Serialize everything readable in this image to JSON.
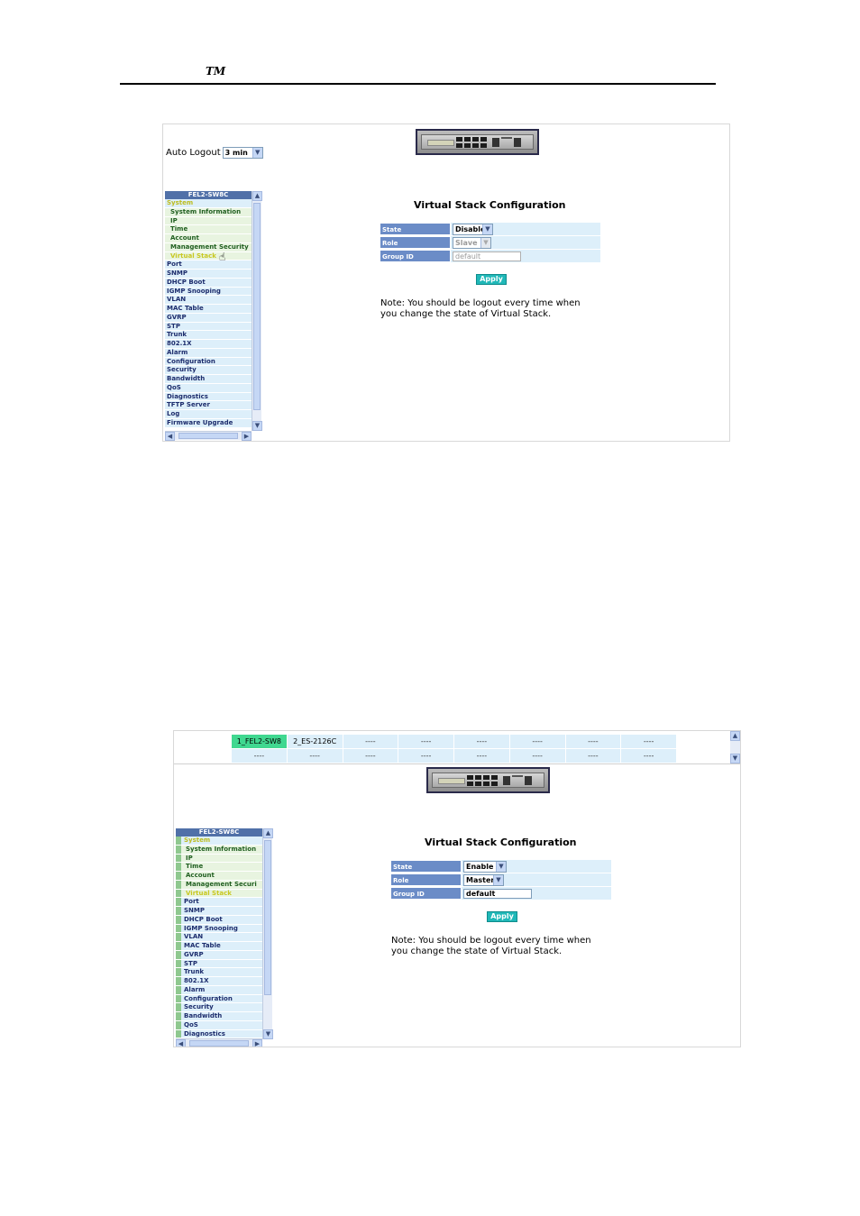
{
  "header": {
    "trademark": "TM"
  },
  "screenshot1": {
    "auto_logout_label": "Auto Logout",
    "auto_logout_value": "3 min",
    "menu_title": "FEL2-SW8C",
    "menu_items": [
      {
        "label": "System",
        "kind": "sys"
      },
      {
        "label": "System Information",
        "kind": "sub"
      },
      {
        "label": "IP",
        "kind": "sub"
      },
      {
        "label": "Time",
        "kind": "sub"
      },
      {
        "label": "Account",
        "kind": "sub"
      },
      {
        "label": "Management Security",
        "kind": "sub"
      },
      {
        "label": "Virtual Stack",
        "kind": "sel"
      },
      {
        "label": "Port",
        "kind": "top"
      },
      {
        "label": "SNMP",
        "kind": "top"
      },
      {
        "label": "DHCP Boot",
        "kind": "top"
      },
      {
        "label": "IGMP Snooping",
        "kind": "top"
      },
      {
        "label": "VLAN",
        "kind": "top"
      },
      {
        "label": "MAC Table",
        "kind": "top"
      },
      {
        "label": "GVRP",
        "kind": "top"
      },
      {
        "label": "STP",
        "kind": "top"
      },
      {
        "label": "Trunk",
        "kind": "top"
      },
      {
        "label": "802.1X",
        "kind": "top"
      },
      {
        "label": "Alarm",
        "kind": "top"
      },
      {
        "label": "Configuration",
        "kind": "top"
      },
      {
        "label": "Security",
        "kind": "top"
      },
      {
        "label": "Bandwidth",
        "kind": "top"
      },
      {
        "label": "QoS",
        "kind": "top"
      },
      {
        "label": "Diagnostics",
        "kind": "top"
      },
      {
        "label": "TFTP Server",
        "kind": "top"
      },
      {
        "label": "Log",
        "kind": "top"
      },
      {
        "label": "Firmware Upgrade",
        "kind": "top"
      }
    ],
    "config": {
      "title": "Virtual Stack Configuration",
      "state_label": "State",
      "state_value": "Disable",
      "role_label": "Role",
      "role_value": "Slave",
      "group_label": "Group ID",
      "group_value": "default",
      "apply_label": "Apply",
      "note_line1": "Note: You should be logout every time when",
      "note_line2": "you change the state of Virtual Stack."
    }
  },
  "screenshot2": {
    "stack_row1": [
      "1_FEL2-SW8",
      "2_ES-2126C",
      "----",
      "----",
      "----",
      "----",
      "----",
      "----"
    ],
    "stack_row2": [
      "----",
      "----",
      "----",
      "----",
      "----",
      "----",
      "----",
      "----"
    ],
    "menu_title": "FEL2-SW8C",
    "menu_items": [
      {
        "label": "System",
        "kind": "sys"
      },
      {
        "label": "System Information",
        "kind": "sub"
      },
      {
        "label": "IP",
        "kind": "sub"
      },
      {
        "label": "Time",
        "kind": "sub"
      },
      {
        "label": "Account",
        "kind": "sub"
      },
      {
        "label": "Management Securi",
        "kind": "sub"
      },
      {
        "label": "Virtual Stack",
        "kind": "sel"
      },
      {
        "label": "Port",
        "kind": "top"
      },
      {
        "label": "SNMP",
        "kind": "top"
      },
      {
        "label": "DHCP Boot",
        "kind": "top"
      },
      {
        "label": "IGMP Snooping",
        "kind": "top"
      },
      {
        "label": "VLAN",
        "kind": "top"
      },
      {
        "label": "MAC Table",
        "kind": "top"
      },
      {
        "label": "GVRP",
        "kind": "top"
      },
      {
        "label": "STP",
        "kind": "top"
      },
      {
        "label": "Trunk",
        "kind": "top"
      },
      {
        "label": "802.1X",
        "kind": "top"
      },
      {
        "label": "Alarm",
        "kind": "top"
      },
      {
        "label": "Configuration",
        "kind": "top"
      },
      {
        "label": "Security",
        "kind": "top"
      },
      {
        "label": "Bandwidth",
        "kind": "top"
      },
      {
        "label": "QoS",
        "kind": "top"
      },
      {
        "label": "Diagnostics",
        "kind": "top"
      }
    ],
    "config": {
      "title": "Virtual Stack Configuration",
      "state_label": "State",
      "state_value": "Enable",
      "role_label": "Role",
      "role_value": "Master",
      "group_label": "Group ID",
      "group_value": "default",
      "apply_label": "Apply",
      "note_line1": "Note: You should be logout every time when",
      "note_line2": "you change the state of Virtual Stack."
    }
  }
}
